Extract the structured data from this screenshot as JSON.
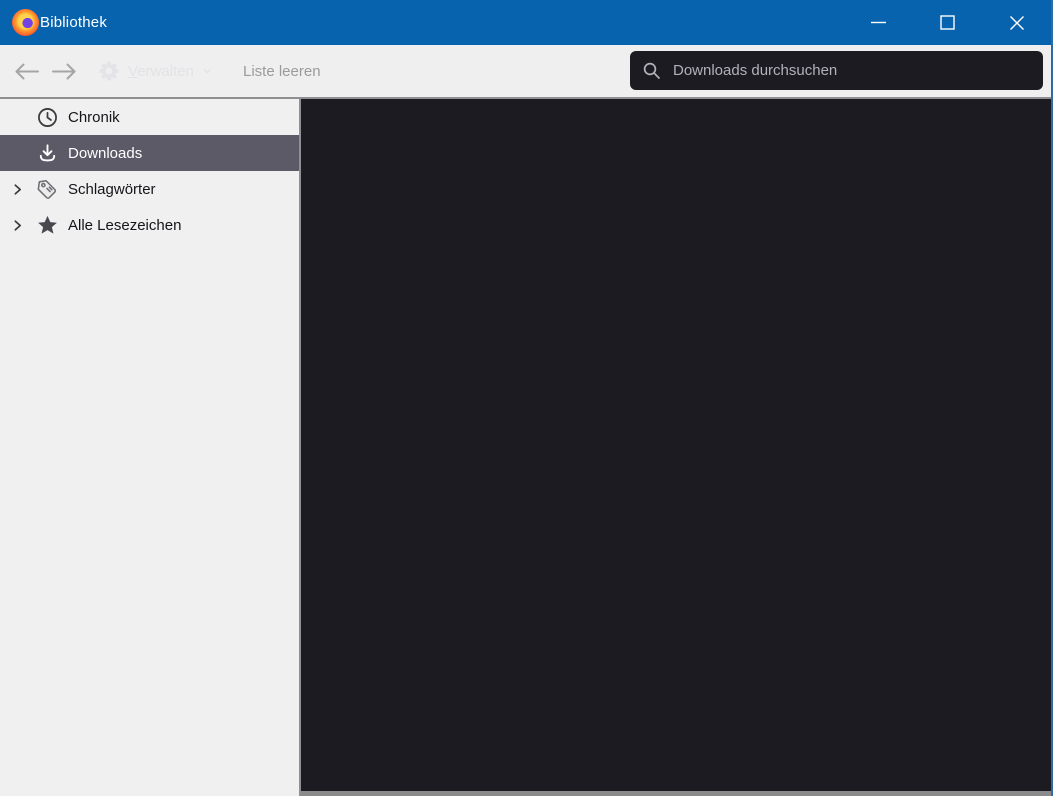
{
  "window": {
    "title": "Bibliothek",
    "controls": {
      "minimize": "minimize",
      "maximize": "maximize",
      "close": "close"
    }
  },
  "toolbar": {
    "back": "back",
    "forward": "forward",
    "organize_label": "Verwalten",
    "organize_accesskey": "V",
    "organize_disabled": true,
    "clear_list_label": "Liste leeren",
    "clear_list_disabled": true,
    "search_placeholder": "Downloads durchsuchen",
    "search_value": ""
  },
  "sidebar": {
    "items": [
      {
        "label": "Chronik",
        "icon": "clock-icon",
        "expandable": false,
        "selected": false
      },
      {
        "label": "Downloads",
        "icon": "download-icon",
        "expandable": false,
        "selected": true
      },
      {
        "label": "Schlagwörter",
        "icon": "tag-icon",
        "expandable": true,
        "selected": false
      },
      {
        "label": "Alle Lesezeichen",
        "icon": "star-icon",
        "expandable": true,
        "selected": false
      }
    ]
  },
  "content": {
    "downloads": []
  },
  "colors": {
    "titlebar-bg": "#0763ae",
    "toolbar-bg": "#efefef",
    "sidebar-bg": "#f0f0f0",
    "sidebar-selected-bg": "#5c5a66",
    "content-bg": "#1c1b22",
    "search-bg": "#1c1b22",
    "search-placeholder": "#b2b0ba",
    "disabled-text": "#9b9b9b",
    "disabled-light-text": "#e3e3e7",
    "text": "#15141a",
    "border-line": "#8f8f94",
    "window-border": "#2b6ca8"
  }
}
